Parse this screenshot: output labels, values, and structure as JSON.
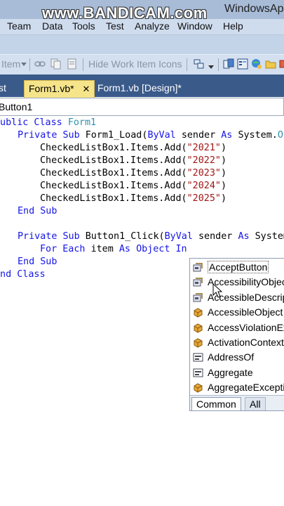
{
  "window": {
    "watermark": "www.BANDICAM.com",
    "title": "WindowsAp"
  },
  "menu": {
    "items": [
      "Team",
      "Data",
      "Tools",
      "Test",
      "Analyze",
      "Window",
      "Help"
    ]
  },
  "toolbar": {
    "item_label": "Item",
    "hide_icons_label": "Hide Work Item Icons"
  },
  "tabs": [
    {
      "label": "st"
    },
    {
      "label": "Form1.vb*",
      "close": "✕"
    },
    {
      "label": "Form1.vb [Design]*"
    }
  ],
  "navbar": {
    "member": "Button1"
  },
  "code": {
    "l1_kw": "Public Class",
    "l1_type": "Form1",
    "l2_kw": "Private Sub",
    "l2_name": "Form1_Load(",
    "l2_byval": "ByVal",
    "l2_sender": "sender",
    "l2_as": "As",
    "l2_ns": "System.",
    "l2_obj": "Ob",
    "add_prefix": "CheckedListBox1.Items.Add(",
    "years": [
      "\"2021\"",
      "\"2022\"",
      "\"2023\"",
      "\"2024\"",
      "\"2025\""
    ],
    "close_paren": ")",
    "end_sub": "End Sub",
    "l9_kw": "Private Sub",
    "l9_name": "Button1_Click(",
    "l9_byval": "ByVal",
    "l9_sender": "sender",
    "l9_as": "As",
    "l9_ns": "System",
    "l10_for": "For Each",
    "l10_item": "item",
    "l10_as": "As",
    "l10_obj": "Object",
    "l10_in": "In",
    "end_class": "End Class"
  },
  "autocomplete": {
    "items": [
      {
        "label": "AcceptButton",
        "icon": "property-icon"
      },
      {
        "label": "AccessibilityObject",
        "icon": "property-icon"
      },
      {
        "label": "AccessibleDescription",
        "icon": "property-icon"
      },
      {
        "label": "AccessibleObject",
        "icon": "class-icon"
      },
      {
        "label": "AccessViolationException",
        "icon": "class-icon"
      },
      {
        "label": "ActivationContext",
        "icon": "class-icon"
      },
      {
        "label": "AddressOf",
        "icon": "keyword-icon"
      },
      {
        "label": "Aggregate",
        "icon": "keyword-icon"
      },
      {
        "label": "AggregateException",
        "icon": "class-icon"
      }
    ],
    "tabs": [
      "Common",
      "All"
    ]
  },
  "colors": {
    "keyword": "#1515e8",
    "type": "#2b91af",
    "string": "#a31515",
    "active_tab": "#f6e48a",
    "tab_strip": "#3a5a8a"
  }
}
